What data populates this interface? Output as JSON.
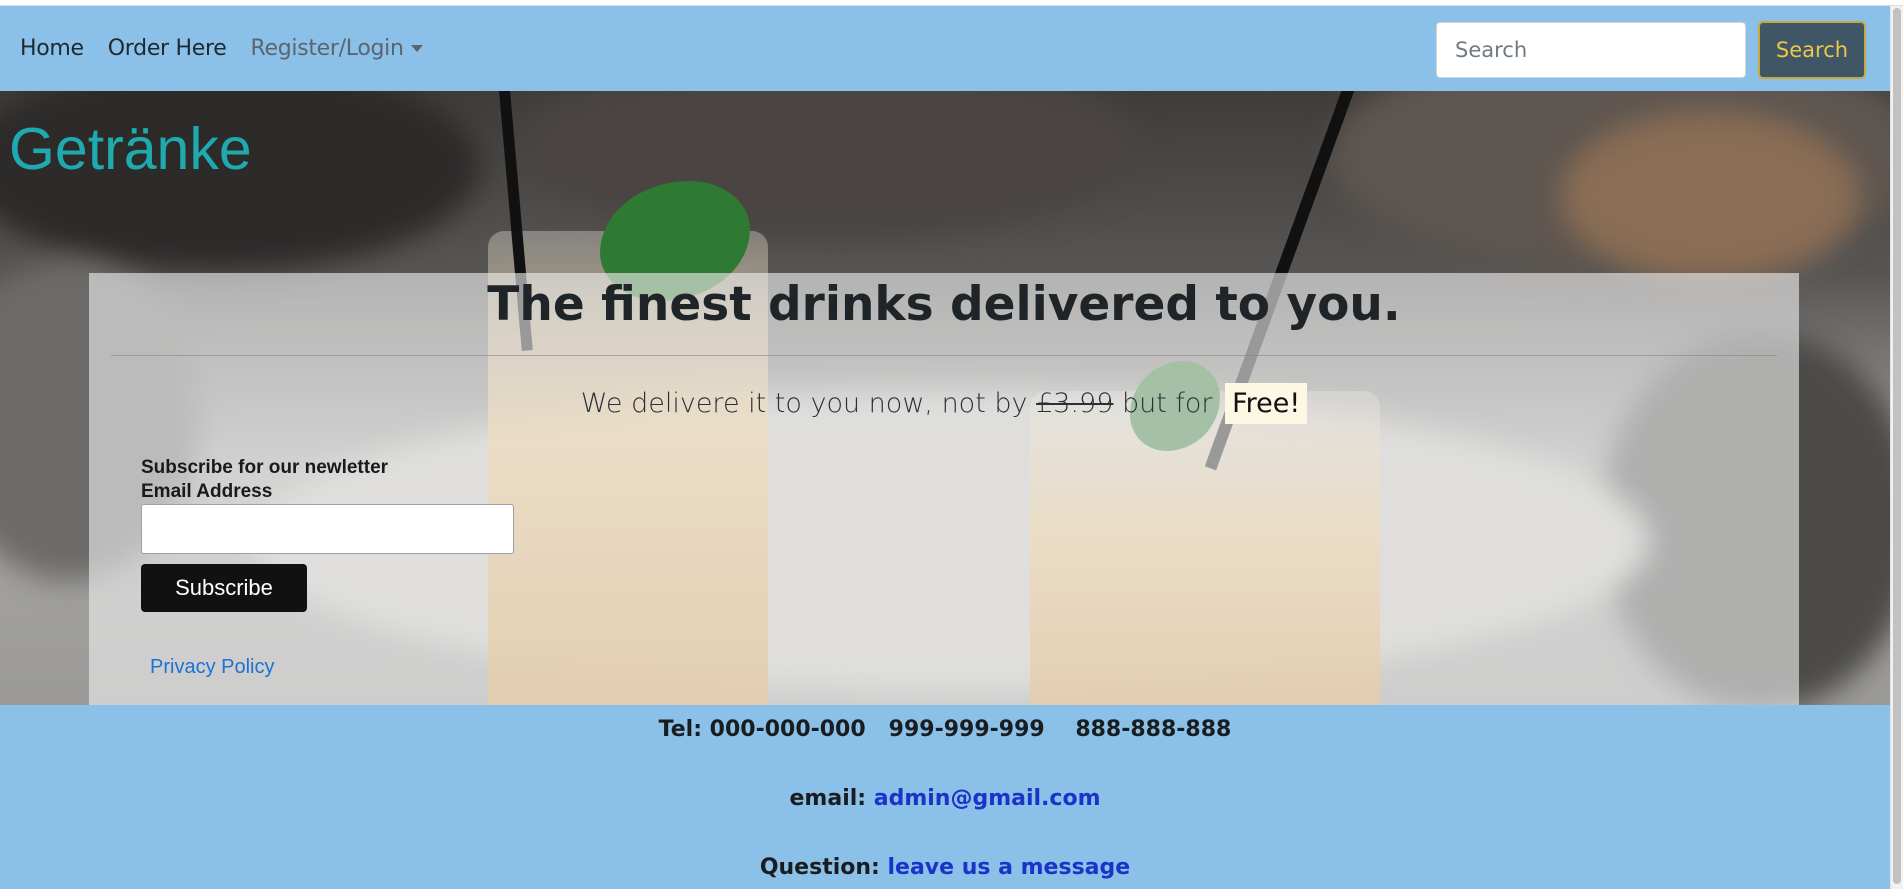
{
  "nav": {
    "links": [
      "Home",
      "Order Here"
    ],
    "dropdown_label": "Register/Login",
    "search_placeholder": "Search",
    "search_button": "Search"
  },
  "brand": "Getränke",
  "hero": {
    "headline": "The finest drinks delivered to you.",
    "lead_prefix": "We delivere it to you now, not by ",
    "old_price": "£3.99",
    "lead_mid": " but for ",
    "free_badge": "Free!"
  },
  "newsletter": {
    "heading": "Subscribe for our newletter",
    "email_label": "Email Address",
    "email_value": "",
    "subscribe_button": "Subscribe"
  },
  "privacy_link": "Privacy Policy",
  "footer": {
    "tel": "Tel: 000-000-000   999-999-999    888-888-888",
    "email_label": "email: ",
    "email_link": "admin@gmail.com",
    "question_label": "Question: ",
    "question_link": "leave us a message"
  },
  "colors": {
    "navbar": "#8bc1e8",
    "brand": "#1faaaf",
    "search_button_bg": "#3e5665",
    "search_button_text": "#f0c649",
    "link": "#1a73d9",
    "footer_link": "#1a33c8"
  },
  "icons": {
    "dropdown": "caret-down-icon"
  }
}
